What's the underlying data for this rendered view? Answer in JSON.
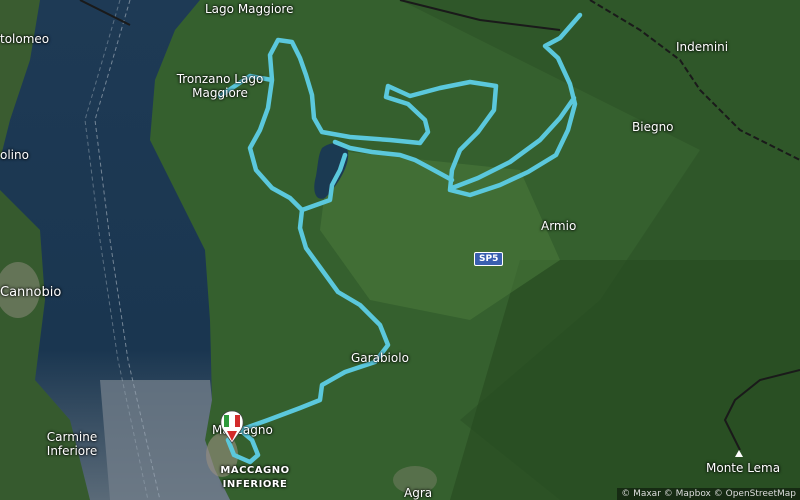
{
  "map": {
    "places": {
      "lago_maggiore": "Lago Maggiore",
      "tronzano_1": "Tronzano Lago",
      "tronzano_2": "Maggiore",
      "indemini": "Indemini",
      "biegno": "Biegno",
      "armio": "Armio",
      "garabiolo": "Garabiolo",
      "cannobio": "Cannobio",
      "carmine_1": "Carmine",
      "carmine_2": "Inferiore",
      "maccagno": "Maccagno",
      "maccagno_inf_1": "MACCAGNO",
      "maccagno_inf_2": "INFERIORE",
      "agra": "Agra",
      "monte_lema": "Monte Lema",
      "lolomeo": "tolomeo",
      "olino": "olino"
    },
    "road_shield": "SP5",
    "attribution": "© Maxar © Mapbox © OpenStreetMap",
    "colors": {
      "route": "#4fc3d9",
      "lake": "#16324a",
      "forest": "#2f5a2a",
      "border": "#222222"
    }
  }
}
